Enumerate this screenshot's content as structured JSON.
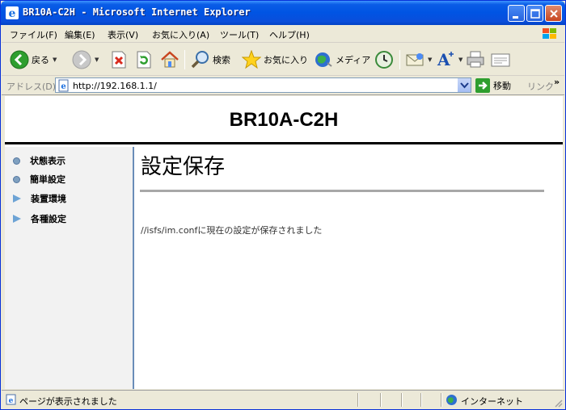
{
  "window": {
    "title": "BR10A-C2H - Microsoft Internet Explorer"
  },
  "menu": {
    "items": [
      "ファイル(F)",
      "編集(E)",
      "表示(V)",
      "お気に入り(A)",
      "ツール(T)",
      "ヘルプ(H)"
    ]
  },
  "toolbar": {
    "back_label": "戻る",
    "search_label": "検索",
    "favorites_label": "お気に入り",
    "media_label": "メディア"
  },
  "address": {
    "label": "アドレス(D)",
    "url": "http://192.168.1.1/",
    "go_label": "移動",
    "links_label": "リンク"
  },
  "page": {
    "header_title": "BR10A-C2H",
    "nav": [
      {
        "label": "状態表示",
        "bullet": "circle"
      },
      {
        "label": "簡単設定",
        "bullet": "circle"
      },
      {
        "label": "装置環境",
        "bullet": "triangle"
      },
      {
        "label": "各種設定",
        "bullet": "triangle"
      }
    ],
    "title": "設定保存",
    "message": "//isfs/im.confに現在の設定が保存されました"
  },
  "status": {
    "text": "ページが表示されました",
    "zone": "インターネット"
  },
  "colors": {
    "titlebar": "#0054E3",
    "nav_background": "#F2F2F2",
    "nav_divider": "#6A8DB8"
  }
}
